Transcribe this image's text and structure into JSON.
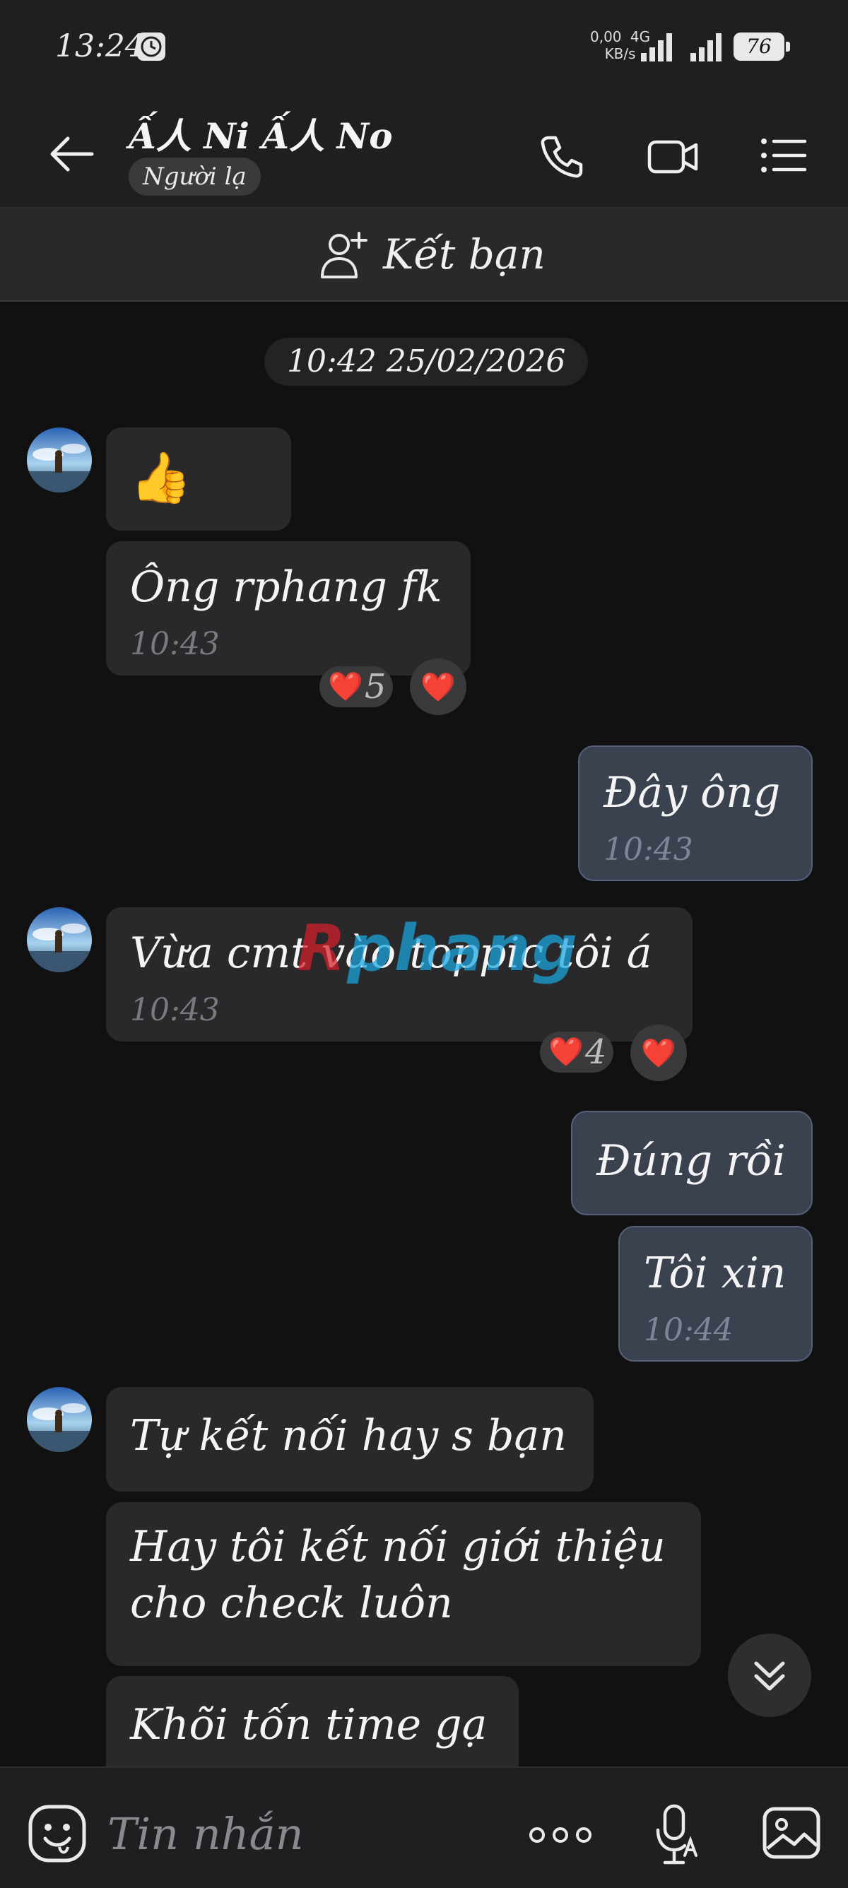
{
  "status_bar": {
    "time": "13:24",
    "net_speed_value": "0,00",
    "net_speed_unit": "KB/s",
    "network_type": "4G",
    "battery": "76"
  },
  "header": {
    "contact_name": "Ấ人 Ni Ấ人 No",
    "badge": "Người lạ"
  },
  "add_friend": {
    "label": "Kết bạn"
  },
  "date_separator": "10:42 25/02/2026",
  "messages": [
    {
      "direction": "incoming",
      "text": "👍",
      "time": ""
    },
    {
      "direction": "incoming",
      "text": "Ông rphang fk",
      "time": "10:43",
      "reaction_count": "5"
    },
    {
      "direction": "outgoing",
      "text": "Đây ông",
      "time": "10:43"
    },
    {
      "direction": "incoming",
      "text": "Vừa cmt vào toppic tôi á",
      "time": "10:43",
      "reaction_count": "4"
    },
    {
      "direction": "outgoing",
      "text": "Đúng rồi",
      "time": ""
    },
    {
      "direction": "outgoing",
      "text": "Tôi xin",
      "time": "10:44"
    },
    {
      "direction": "incoming",
      "text": "Tự kết nối hay s bạn",
      "time": ""
    },
    {
      "direction": "incoming",
      "text": "Hay tôi kết nối giới thiệu",
      "text_line2": "cho check luôn",
      "time": ""
    },
    {
      "direction": "incoming",
      "text": "Khõi tốn time gạ",
      "time": ""
    }
  ],
  "reaction_emoji": "❤️",
  "watermark": {
    "first": "R",
    "rest": "phang"
  },
  "input": {
    "placeholder": "Tin nhắn"
  },
  "colors": {
    "background": "#111112",
    "bar": "#1f1f21",
    "incoming_bubble": "#29292b",
    "outgoing_bubble": "#3a4250",
    "watermark_red": "#d81f2a",
    "watermark_blue": "#1aa7e0"
  }
}
